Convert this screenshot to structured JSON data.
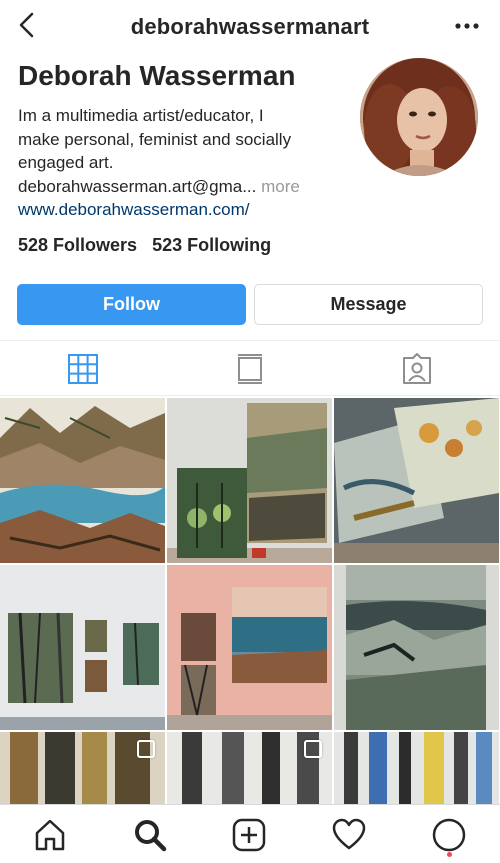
{
  "header": {
    "title": "deborahwassermanart",
    "back_icon": "chevron-left-icon",
    "more_icon": "ellipsis-icon"
  },
  "profile": {
    "name": "Deborah Wasserman",
    "bio_line1": "Im a multimedia artist/educator, I",
    "bio_line2": "make personal, feminist and socially",
    "bio_line3": "engaged art.",
    "bio_line4": "deborahwasserman.art@gma...",
    "more_label": "more",
    "website": "www.deborahwasserman.com/",
    "followers": "528 Followers",
    "following": "523 Following"
  },
  "actions": {
    "follow_label": "Follow",
    "message_label": "Message",
    "follow_color": "#3897f0"
  },
  "tabs": [
    {
      "name": "grid",
      "icon": "grid-icon",
      "active": true
    },
    {
      "name": "feed",
      "icon": "feed-icon",
      "active": false
    },
    {
      "name": "tagged",
      "icon": "tagged-icon",
      "active": false
    }
  ],
  "posts": [
    {
      "description": "landscape painting"
    },
    {
      "description": "paintings on gallery wall"
    },
    {
      "description": "abstract flower paintings"
    },
    {
      "description": "three forest paintings on white wall"
    },
    {
      "description": "sea paintings on pink wall"
    },
    {
      "description": "stormy landscape painting"
    },
    {
      "description": "tree trunks painting",
      "multiple": true
    },
    {
      "description": "birch trees painting",
      "multiple": true
    },
    {
      "description": "blue forest painting"
    }
  ],
  "bottom_nav": [
    {
      "icon": "home-icon"
    },
    {
      "icon": "search-icon",
      "active": true
    },
    {
      "icon": "add-post-icon"
    },
    {
      "icon": "heart-icon"
    },
    {
      "icon": "profile-icon"
    }
  ]
}
